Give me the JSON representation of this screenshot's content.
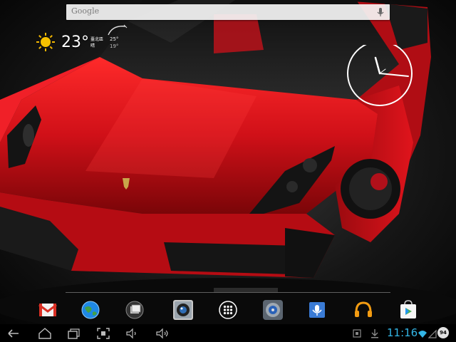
{
  "search": {
    "logo_text": "Google"
  },
  "weather": {
    "temperature": "23°",
    "location_line1": "臺北區",
    "location_line2": "晴",
    "high": "25°",
    "low": "19°"
  },
  "status_bar": {
    "time": "11:16",
    "battery_level": "94",
    "accent_color": "#33b5e5"
  },
  "dock": {
    "apps": [
      {
        "name": "gmail",
        "icon": "gmail-icon"
      },
      {
        "name": "browser",
        "icon": "globe-icon"
      },
      {
        "name": "gallery",
        "icon": "gallery-icon"
      },
      {
        "name": "camera",
        "icon": "camera-icon"
      },
      {
        "name": "app-drawer",
        "icon": "grid-icon"
      },
      {
        "name": "settings",
        "icon": "settings-icon"
      },
      {
        "name": "voice-search",
        "icon": "voice-icon"
      },
      {
        "name": "play-music",
        "icon": "headphones-icon"
      },
      {
        "name": "play-store",
        "icon": "play-store-icon"
      }
    ]
  },
  "navigation": {
    "buttons": [
      "back",
      "home",
      "recent-apps",
      "screenshot",
      "volume-down",
      "volume-up"
    ]
  },
  "colors": {
    "car_red": "#c8101a",
    "wallpaper_dark": "#0d0d0d"
  }
}
